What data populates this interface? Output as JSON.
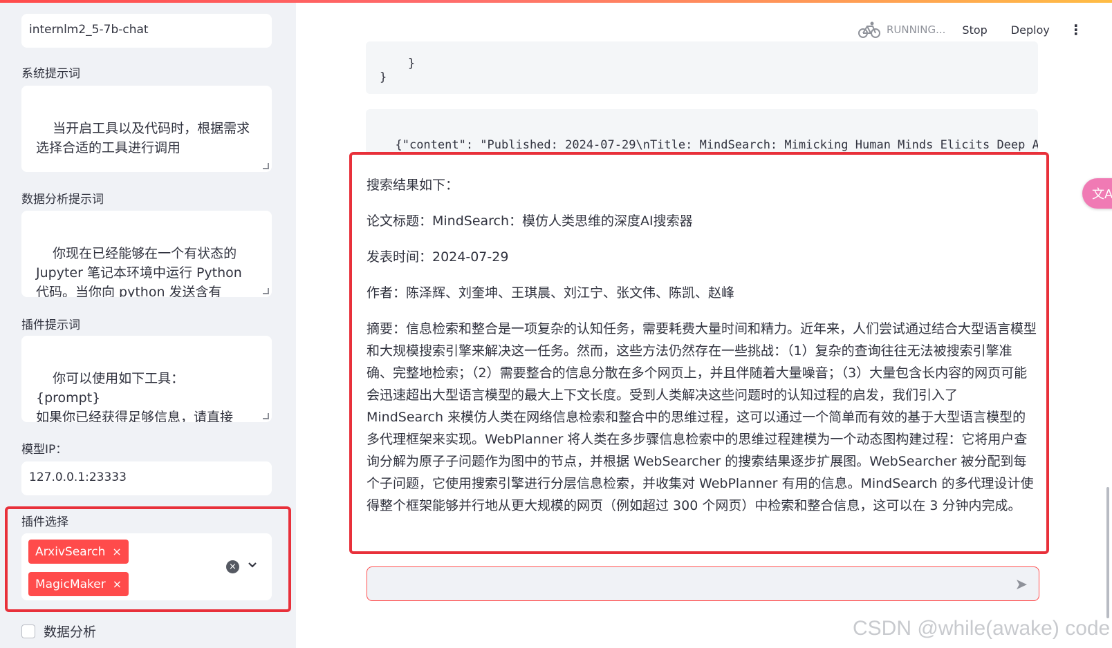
{
  "sidebar": {
    "model_name_value": "internlm2_5-7b-chat",
    "system_prompt_label": "系统提示词",
    "system_prompt_value": "当开启工具以及代码时，根据需求\n选择合适的工具进行调用",
    "data_prompt_label": "数据分析提示词",
    "data_prompt_value": "你现在已经能够在一个有状态的\nJupyter 笔记本环境中运行 Python\n代码。当你向 python 发送含有\nPython 代码的消息时，它将在该环",
    "plugin_prompt_label": "插件提示词",
    "plugin_prompt_value": "你可以使用如下工具：\n{prompt}\n如果你已经获得足够信息，请直接\n给出答案.避免不必要的工具调用!",
    "model_ip_label": "模型IP：",
    "model_ip_value": "127.0.0.1:23333",
    "plugin_select_label": "插件选择",
    "plugins": [
      {
        "label": "ArxivSearch",
        "x": "×"
      },
      {
        "label": "MagicMaker",
        "x": "×"
      }
    ],
    "clear_glyph": "×",
    "chevron_glyph": "⌄",
    "data_analysis_label": "数据分析"
  },
  "header": {
    "running_label": "RUNNING...",
    "stop_label": "Stop",
    "deploy_label": "Deploy",
    "menu_glyph": "⋮"
  },
  "main": {
    "code_block_1_lines": "  }\n}",
    "code_block_2": "{\"content\": \"Published: 2024-07-29\\nTitle: MindSearch: Mimicking Human Minds Elicits Deep AI",
    "result_intro": "搜索结果如下：",
    "result_title": "论文标题：MindSearch：模仿人类思维的深度AI搜索器",
    "result_date": "发表时间：2024-07-29",
    "result_authors": "作者：陈泽辉、刘奎坤、王琪晨、刘江宁、张文伟、陈凯、赵峰",
    "result_abstract": "摘要：信息检索和整合是一项复杂的认知任务，需要耗费大量时间和精力。近年来，人们尝试通过结合大型语言模型和大规模搜索引擎来解决这一任务。然而，这些方法仍然存在一些挑战：（1）复杂的查询往往无法被搜索引擎准确、完整地检索；（2）需要整合的信息分散在多个网页上，并且伴随着大量噪音；（3）大量包含长内容的网页可能会迅速超出大型语言模型的最大上下文长度。受到人类解决这些问题时的认知过程的启发，我们引入了 MindSearch 来模仿人类在网络信息检索和整合中的思维过程，这可以通过一个简单而有效的基于大型语言模型的多代理框架来实现。WebPlanner 将人类在多步骤信息检索中的思维过程建模为一个动态图构建过程：它将用户查询分解为原子子问题作为图中的节点，并根据 WebSearcher 的搜索结果逐步扩展图。WebSearcher 被分配到每个子问题，它使用搜索引擎进行分层信息检索，并收集对 WebPlanner 有用的信息。MindSearch 的多代理设计使得整个框架能够并行地从更大规模的网页（例如超过 300 个网页）中检索和整合信息，这可以在 3 分钟内完成。",
    "chat_placeholder": "",
    "send_glyph": "➤"
  },
  "translate_glyph": "文A",
  "watermark": "CSDN @while(awake) code",
  "colors": {
    "accent": "#ff4b4b",
    "annotation_red": "#e8303a",
    "sidebar_bg": "#f0f2f6"
  }
}
